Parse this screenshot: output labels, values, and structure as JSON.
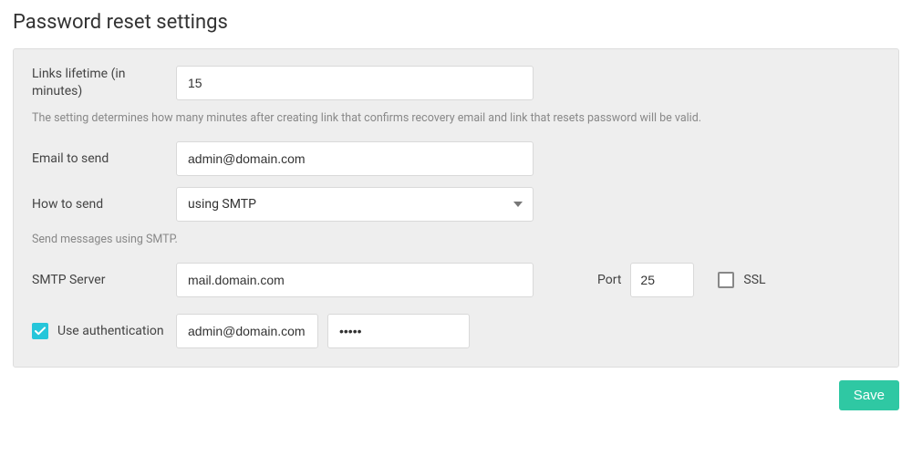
{
  "page": {
    "title": "Password reset settings"
  },
  "form": {
    "linksLifetime": {
      "label": "Links lifetime (in minutes)",
      "value": "15",
      "hint": "The setting determines how many minutes after creating link that confirms recovery email and link that resets password will be valid."
    },
    "emailToSend": {
      "label": "Email to send",
      "value": "admin@domain.com"
    },
    "howToSend": {
      "label": "How to send",
      "value": "using SMTP",
      "hint": "Send messages using SMTP."
    },
    "smtpServer": {
      "label": "SMTP Server",
      "value": "mail.domain.com"
    },
    "port": {
      "label": "Port",
      "value": "25"
    },
    "ssl": {
      "label": "SSL",
      "checked": false
    },
    "useAuth": {
      "label": "Use authentication",
      "checked": true,
      "username": "admin@domain.com",
      "password": "•••••"
    }
  },
  "buttons": {
    "save": "Save"
  }
}
